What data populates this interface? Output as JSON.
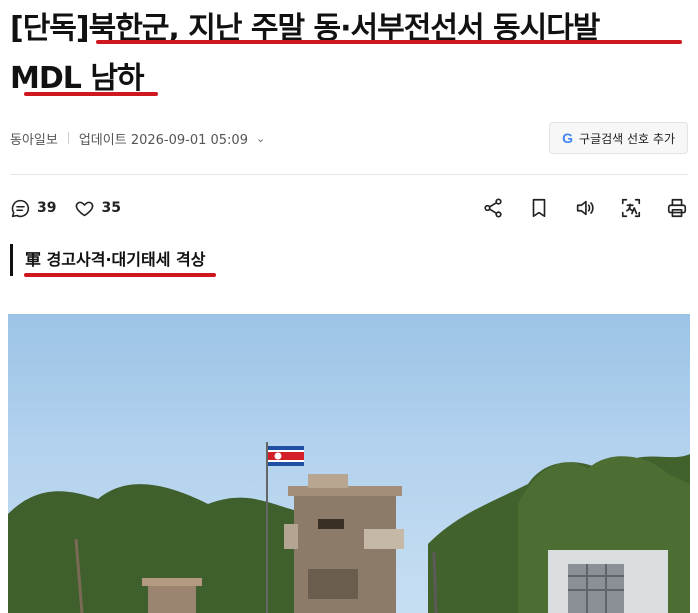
{
  "headline": {
    "line1": "[단독]북한군, 지난 주말 동·서부전선서 동시다발",
    "line2": "MDL 남하"
  },
  "meta": {
    "publisher": "동아일보",
    "updated": "업데이트 2026-09-01 05:09",
    "google_button": "구글검색 선호 추가"
  },
  "actions": {
    "comments": "39",
    "likes": "35",
    "icons": [
      "share-icon",
      "bookmark-icon",
      "speaker-icon",
      "translate-icon",
      "print-icon"
    ]
  },
  "subhead": "軍 경고사격·대기태세 격상",
  "colors": {
    "accent_underline": "#d0161e",
    "sky": "#b3d2ee"
  }
}
